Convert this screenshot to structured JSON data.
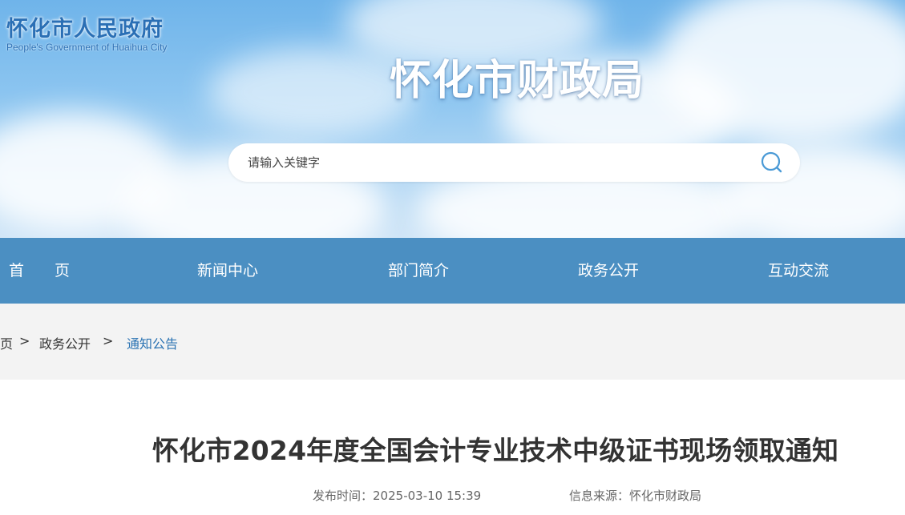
{
  "header": {
    "logo_cn": "怀化市人民政府",
    "logo_en": "People's Government of Huaihua City",
    "site_title": "怀化市财政局"
  },
  "search": {
    "placeholder": "请输入关键字",
    "icon": "search-icon"
  },
  "colors": {
    "nav_bg": "#4b8fc2",
    "breadcrumb_current": "#2b73b3",
    "breadcrumb_bg": "#f3f3f3"
  },
  "nav": {
    "items": [
      {
        "label": "首　　页"
      },
      {
        "label": "新闻中心"
      },
      {
        "label": "部门简介"
      },
      {
        "label": "政务公开"
      },
      {
        "label": "互动交流"
      }
    ]
  },
  "breadcrumb": {
    "items": [
      {
        "label": "页"
      },
      {
        "label": "政务公开"
      },
      {
        "label": "通知公告"
      }
    ],
    "separator": ">"
  },
  "article": {
    "title": "怀化市2024年度全国会计专业技术中级证书现场领取通知",
    "publish_time_label": "发布时间：",
    "publish_time": "2025-03-10 15:39",
    "source_label": "信息来源：",
    "source": "怀化市财政局"
  }
}
